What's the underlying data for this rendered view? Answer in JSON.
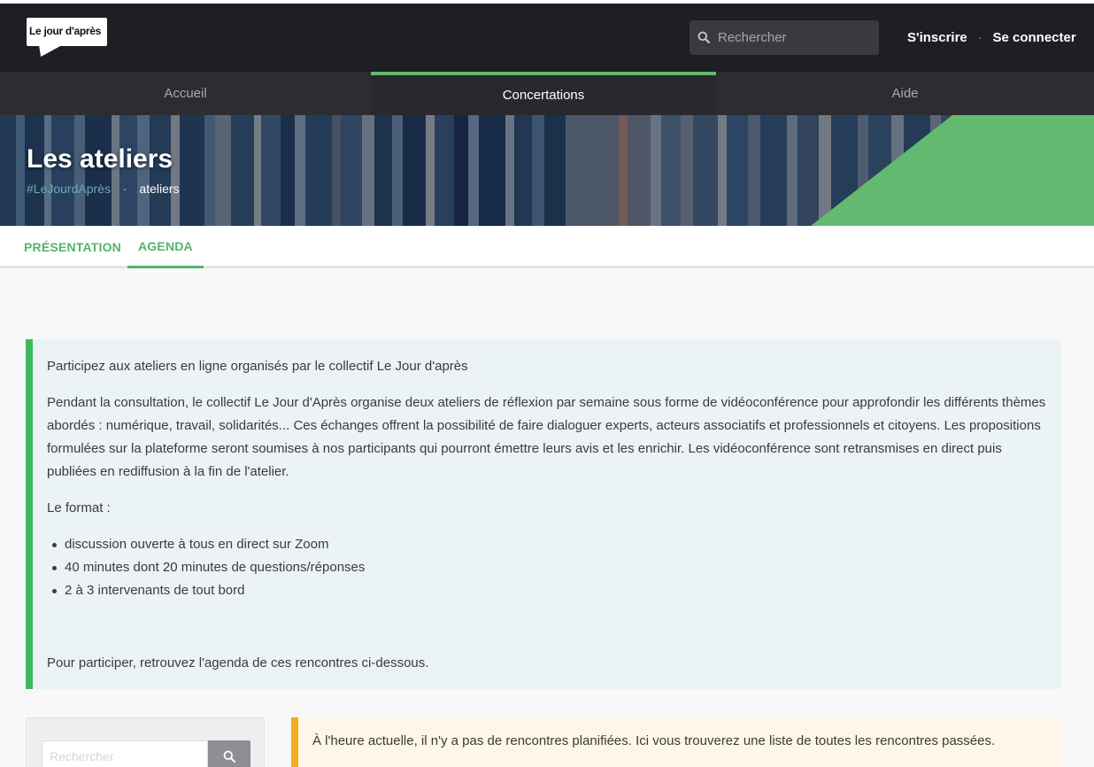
{
  "header": {
    "logo_text": "Le jour d'après",
    "search_placeholder": "Rechercher",
    "signup_label": "S'inscrire",
    "signin_label": "Se connecter",
    "separator": "·"
  },
  "nav": {
    "items": [
      {
        "label": "Accueil",
        "active": false
      },
      {
        "label": "Concertations",
        "active": true
      },
      {
        "label": "Aide",
        "active": false
      }
    ]
  },
  "banner": {
    "title": "Les ateliers",
    "hashtag": "#LeJourdAprès",
    "separator": "·",
    "crumb": "ateliers"
  },
  "tabs": [
    {
      "label": "PRÉSENTATION",
      "active": false
    },
    {
      "label": "AGENDA",
      "active": true
    }
  ],
  "intro": {
    "heading": "Participez aux ateliers en ligne organisés par le collectif Le Jour d'après",
    "paragraph": "Pendant la consultation, le collectif Le Jour d'Après organise deux ateliers de réflexion par semaine sous forme de vidéoconférence pour approfondir les différents thèmes abordés : numérique, travail, solidarités... Ces échanges offrent la possibilité de faire dialoguer experts, acteurs associatifs et professionnels et citoyens. Les propositions formulées sur la plateforme seront soumises à nos participants qui pourront émettre leurs avis et les enrichir. Les vidéoconférence sont retransmises en direct puis publiées en rediffusion à la fin de l'atelier.",
    "format_label": "Le format :",
    "format_items": [
      "discussion ouverte à tous en direct sur Zoom",
      "40 minutes dont 20 minutes de questions/réponses",
      "2 à 3 intervenants de tout bord"
    ],
    "closing": "Pour participer, retrouvez l'agenda de ces rencontres ci-dessous."
  },
  "sidebar": {
    "search_placeholder": "Rechercher"
  },
  "notice": {
    "text": "À l'heure actuelle, il n'y a pas de rencontres planifiées. Ici vous trouverez une liste de toutes les rencontres passées."
  },
  "colors": {
    "accent_green": "#55b36b",
    "header_bg": "#1f1e22",
    "nav_bg": "#2d2c31",
    "notice_border": "#f0ae19",
    "intro_border": "#3fb960"
  }
}
